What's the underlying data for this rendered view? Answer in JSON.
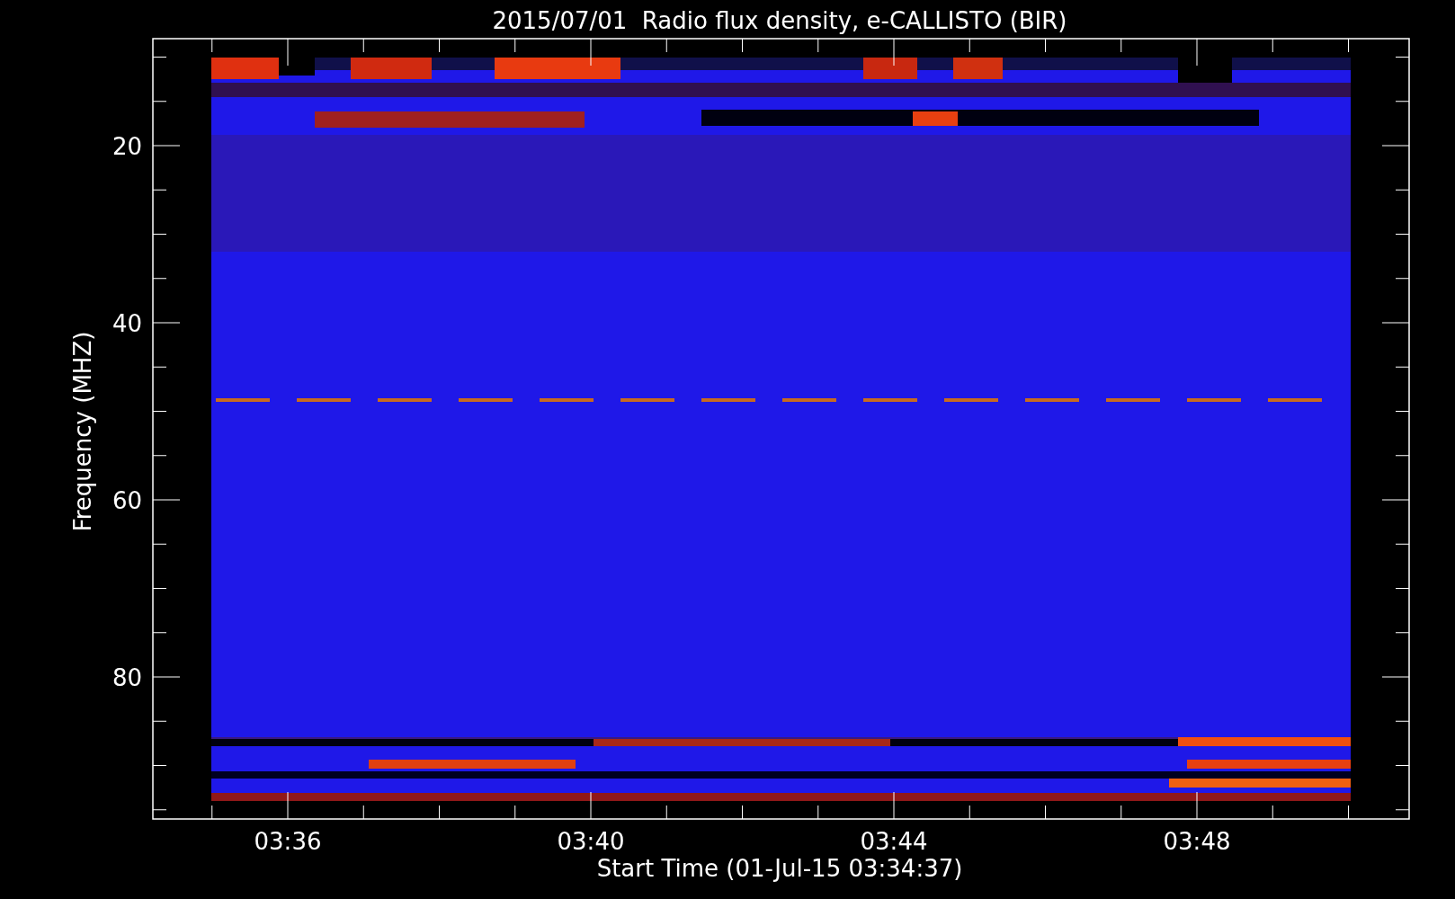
{
  "title": "2015/07/01  Radio flux density, e-CALLISTO (BIR)",
  "y_axis": {
    "label": "Frequency (MHZ)",
    "ticks": [
      "20",
      "40",
      "60",
      "80"
    ]
  },
  "x_axis": {
    "label": "Start Time (01-Jul-15 03:34:37)",
    "ticks": [
      "03:36",
      "03:40",
      "03:44",
      "03:48"
    ]
  }
}
